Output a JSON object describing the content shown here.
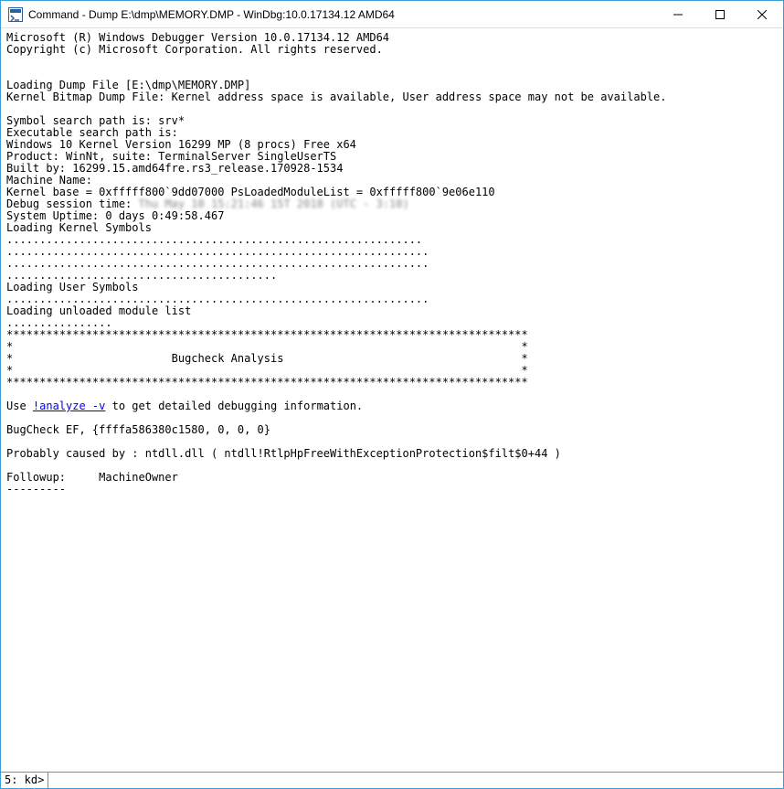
{
  "window": {
    "title": "Command - Dump E:\\dmp\\MEMORY.DMP - WinDbg:10.0.17134.12 AMD64"
  },
  "output": {
    "line1": "Microsoft (R) Windows Debugger Version 10.0.17134.12 AMD64",
    "line2": "Copyright (c) Microsoft Corporation. All rights reserved.",
    "blank1": "",
    "blank2": "",
    "loading1": "Loading Dump File [E:\\dmp\\MEMORY.DMP]",
    "loading2": "Kernel Bitmap Dump File: Kernel address space is available, User address space may not be available.",
    "blank3": "",
    "sympath": "Symbol search path is: srv*",
    "exepath": "Executable search path is: ",
    "winver": "Windows 10 Kernel Version 16299 MP (8 procs) Free x64",
    "product": "Product: WinNt, suite: TerminalServer SingleUserTS",
    "built": "Built by: 16299.15.amd64fre.rs3_release.170928-1534",
    "machine": "Machine Name:",
    "kbase": "Kernel base = 0xfffff800`9dd07000 PsLoadedModuleList = 0xfffff800`9e06e110",
    "dsession_pre": "Debug session time: ",
    "dsession_blur": "Thu May 10 15:21:46 15T 2018 (UTC - 3:10)",
    "uptime": "System Uptime: 0 days 0:49:58.467",
    "lks": "Loading Kernel Symbols",
    "dots1": "...............................................................",
    "dots2": "................................................................",
    "dots3": "................................................................",
    "dots4": ".........................................",
    "lus": "Loading User Symbols",
    "dots5": "................................................................",
    "luml": "Loading unloaded module list",
    "dots6": "................",
    "stars1": "*******************************************************************************",
    "stars2": "*                                                                             *",
    "stars3": "*                        Bugcheck Analysis                                    *",
    "stars4": "*                                                                             *",
    "stars5": "*******************************************************************************",
    "blank4": "",
    "use_pre": "Use ",
    "use_link": "!analyze -v",
    "use_post": " to get detailed debugging information.",
    "blank5": "",
    "bugcheck": "BugCheck EF, {ffffa586380c1580, 0, 0, 0}",
    "blank6": "",
    "probably": "Probably caused by : ntdll.dll ( ntdll!RtlpHpFreeWithExceptionProtection$filt$0+44 )",
    "blank7": "",
    "followup": "Followup:     MachineOwner",
    "dashes": "---------",
    "blank8": ""
  },
  "prompt": {
    "label": "5: kd>",
    "value": ""
  }
}
